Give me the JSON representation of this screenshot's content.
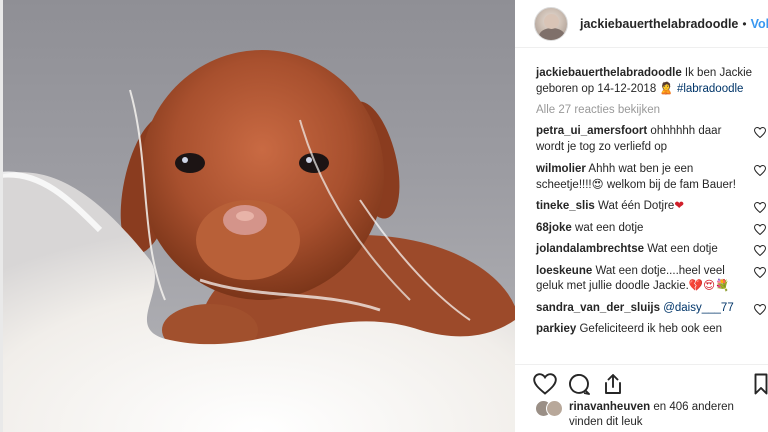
{
  "header": {
    "username": "jackiebauerthelabradoodle",
    "separator": "•",
    "follow_label": "Volgen"
  },
  "caption": {
    "username": "jackiebauerthelabradoodle",
    "text": "Ik ben Jackie geboren op 14-12-2018 ",
    "emoji": "woman-icon",
    "hashtag": "#labradoodle"
  },
  "view_all": "Alle 27 reacties bekijken",
  "comments": [
    {
      "username": "petra_ui_amersfoort",
      "text": "ohhhhhh daar wordt je tog zo verliefd op"
    },
    {
      "username": "wilmolier",
      "text": "Ahhh wat ben je een scheetje!!!!",
      "emoji": "heart-eyes-icon",
      "text2": " welkom bij de fam Bauer!"
    },
    {
      "username": "tineke_slis",
      "text": "Wat één Dotjre",
      "emoji": "red-heart-icon"
    },
    {
      "username": "68joke",
      "text": "wat een dotje"
    },
    {
      "username": "jolandalambrechtse",
      "text": "Wat een dotje"
    },
    {
      "username": "loeskeune",
      "text": "Wat een dotje....heel veel geluk met jullie doodle Jackie.",
      "emoji": "heart-emojis-icon"
    },
    {
      "username": "sandra_van_der_sluijs",
      "mention": "@daisy___77"
    },
    {
      "username": "parkiey",
      "text": "Gefeliciteerd ik heb ook een"
    }
  ],
  "actions": {
    "like_icon": "heart-outline-icon",
    "comment_icon": "comment-bubble-icon",
    "share_icon": "share-icon",
    "save_icon": "bookmark-icon"
  },
  "likes": {
    "first_user": "rinavanheuven",
    "rest": " en 406 anderen",
    "line2": "vinden dit leuk"
  },
  "colors": {
    "link_blue": "#3897f0",
    "hashtag_blue": "#003569",
    "muted_gray": "#999999",
    "text": "#262626"
  }
}
